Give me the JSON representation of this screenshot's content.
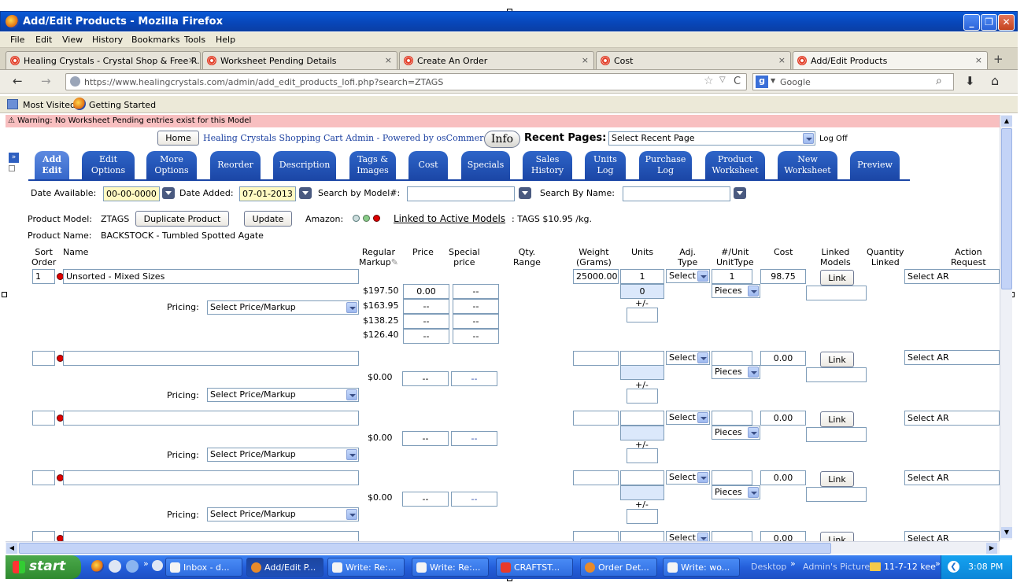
{
  "window": {
    "title": "Add/Edit Products - Mozilla Firefox"
  },
  "menu": [
    "File",
    "Edit",
    "View",
    "History",
    "Bookmarks",
    "Tools",
    "Help"
  ],
  "tabs": [
    {
      "label": "Healing Crystals - Crystal Shop & Free R..."
    },
    {
      "label": "Worksheet Pending Details"
    },
    {
      "label": "Create An Order"
    },
    {
      "label": "Cost"
    },
    {
      "label": "Add/Edit Products"
    }
  ],
  "url": "https://www.healingcrystals.com/admin/add_edit_products_lofi.php?search=ZTAGS",
  "search_placeholder": "Google",
  "bookmarks": [
    "Most Visited",
    "Getting Started"
  ],
  "warning": "Warning:   No Worksheet Pending entries exist for this Model",
  "header": {
    "home": "Home",
    "site_title": "Healing Crystals Shopping Cart Admin - Powered by osCommerce",
    "info": "Info",
    "recent_pages_label": "Recent Pages:",
    "recent_pages_value": "Select Recent Page",
    "logoff": "Log Off"
  },
  "page_tabs": [
    {
      "line1": "Add",
      "line2": "Edit",
      "active": true
    },
    {
      "line1": "Edit",
      "line2": "Options"
    },
    {
      "line1": "More",
      "line2": "Options"
    },
    {
      "line1": "Reorder",
      "line2": ""
    },
    {
      "line1": "Description",
      "line2": ""
    },
    {
      "line1": "Tags &",
      "line2": "Images"
    },
    {
      "line1": "Cost",
      "line2": ""
    },
    {
      "line1": "Specials",
      "line2": ""
    },
    {
      "line1": "Sales",
      "line2": "History"
    },
    {
      "line1": "Units",
      "line2": "Log"
    },
    {
      "line1": "Purchase",
      "line2": "Log"
    },
    {
      "line1": "Product",
      "line2": "Worksheet"
    },
    {
      "line1": "New",
      "line2": "Worksheet"
    },
    {
      "line1": "Preview",
      "line2": ""
    }
  ],
  "filters": {
    "date_available_label": "Date Available:",
    "date_available": "00-00-0000",
    "date_added_label": "Date Added:",
    "date_added": "07-01-2013",
    "search_model_label": "Search by Model#:",
    "search_name_label": "Search By Name:"
  },
  "product": {
    "model_label": "Product Model:",
    "model": "ZTAGS",
    "duplicate_btn": "Duplicate Product",
    "update_btn": "Update",
    "amazon_label": "Amazon:",
    "linked_active": "Linked to Active Models",
    "tags_price": ": TAGS  $10.95 /kg.",
    "name_label": "Product Name:",
    "name": "BACKSTOCK - Tumbled Spotted Agate"
  },
  "columns": {
    "sort": "Sort",
    "order": "Order",
    "name": "Name",
    "regular": "Regular",
    "markup": "Markup",
    "price": "Price",
    "special": "Special",
    "special2": "price",
    "qty": "Qty.",
    "range": "Range",
    "weight": "Weight",
    "grams": "(Grams)",
    "units": "Units",
    "adj": "Adj.",
    "type": "Type",
    "perunit": "#/Unit",
    "unittype": "UnitType",
    "cost": "Cost",
    "linked": "Linked",
    "models": "Models",
    "quantity": "Quantity",
    "linked2": "Linked",
    "action": "Action",
    "request": "Request"
  },
  "rows": [
    {
      "sort": "1",
      "name": "Unsorted - Mixed Sizes",
      "weight": "25000.00",
      "units": "1",
      "units_sub": "0",
      "adj": "Select",
      "perunit": "1",
      "unittype": "Pieces",
      "cost": "98.75",
      "link": "Link",
      "action": "Select AR",
      "pricing_label": "Pricing:",
      "pricing": "Select Price/Markup",
      "plusminus": "+/-",
      "tiers": [
        {
          "regular": "$197.50",
          "price": "0.00",
          "special": "--"
        },
        {
          "regular": "$163.95",
          "price": "--",
          "special": "--"
        },
        {
          "regular": "$138.25",
          "price": "--",
          "special": "--"
        },
        {
          "regular": "$126.40",
          "price": "--",
          "special": "--"
        }
      ]
    },
    {
      "sort": "",
      "name": "",
      "weight": "",
      "units": "",
      "adj": "Select",
      "perunit": "",
      "unittype": "Pieces",
      "cost": "0.00",
      "link": "Link",
      "action": "Select AR",
      "pricing_label": "Pricing:",
      "pricing": "Select Price/Markup",
      "plusminus": "+/-",
      "regular": "$0.00",
      "price": "--",
      "special": "--"
    },
    {
      "sort": "",
      "name": "",
      "weight": "",
      "units": "",
      "adj": "Select",
      "perunit": "",
      "unittype": "Pieces",
      "cost": "0.00",
      "link": "Link",
      "action": "Select AR",
      "pricing_label": "Pricing:",
      "pricing": "Select Price/Markup",
      "plusminus": "+/-",
      "regular": "$0.00",
      "price": "--",
      "special": "--"
    },
    {
      "sort": "",
      "name": "",
      "weight": "",
      "units": "",
      "adj": "Select",
      "perunit": "",
      "unittype": "Pieces",
      "cost": "0.00",
      "link": "Link",
      "action": "Select AR",
      "pricing_label": "Pricing:",
      "pricing": "Select Price/Markup",
      "plusminus": "+/-",
      "regular": "$0.00",
      "price": "--",
      "special": "--"
    },
    {
      "adj": "Select",
      "cost": "0.00",
      "link": "Link",
      "action": "Select AR"
    }
  ],
  "taskbar": {
    "start": "start",
    "items": [
      "Inbox - d...",
      "Add/Edit P...",
      "Write: Re:...",
      "Write: Re:...",
      "CRAFTST...",
      "Order Det...",
      "Write: wo..."
    ],
    "desktop": "Desktop",
    "admin_pictures": "Admin's Pictures",
    "folder": "11-7-12 kee",
    "time": "3:08 PM"
  }
}
